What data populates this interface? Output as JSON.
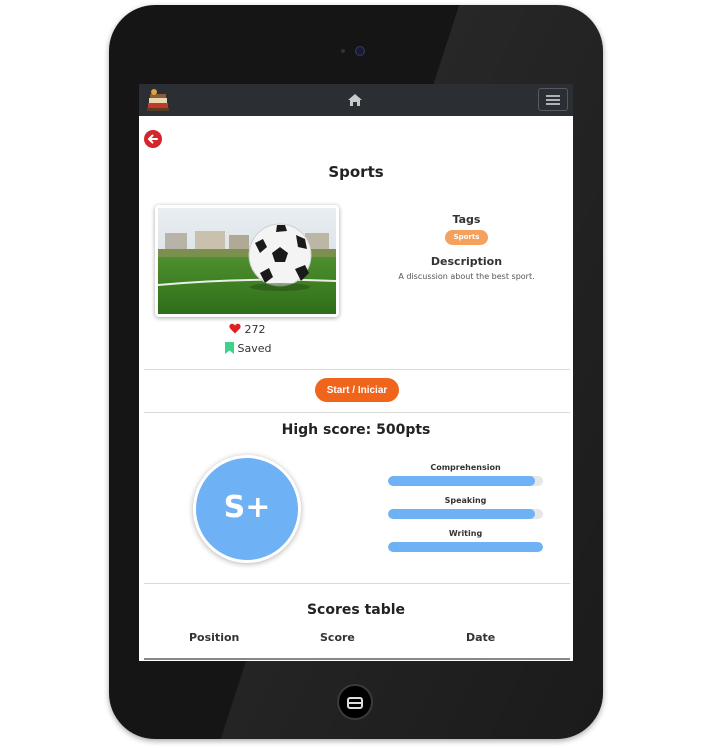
{
  "page": {
    "title": "Sports",
    "tags_label": "Tags",
    "tag": "Sports",
    "description_label": "Description",
    "description": "A discussion about the best sport.",
    "likes": "272",
    "saved": "Saved",
    "start_button": "Start / Iniciar",
    "high_score": "High  score:  500pts",
    "grade": "S+",
    "skills": [
      {
        "label": "Comprehension",
        "value": 0.95
      },
      {
        "label": "Speaking",
        "value": 0.95
      },
      {
        "label": "Writing",
        "value": 1.0
      }
    ],
    "scores_table": {
      "title": "Scores  table",
      "columns": [
        "Position",
        "Score",
        "Date"
      ]
    }
  },
  "colors": {
    "navbar": "#2b2f33",
    "accent_orange": "#f0641b",
    "tag": "#f4a15e",
    "grade_blue": "#6fb1f5",
    "back_red": "#d3262c",
    "saved_green": "#3fd18a",
    "heart_red": "#e02020"
  },
  "icons": [
    "books-logo-icon",
    "home-icon",
    "menu-icon",
    "back-arrow-icon",
    "heart-icon",
    "bookmark-icon"
  ]
}
